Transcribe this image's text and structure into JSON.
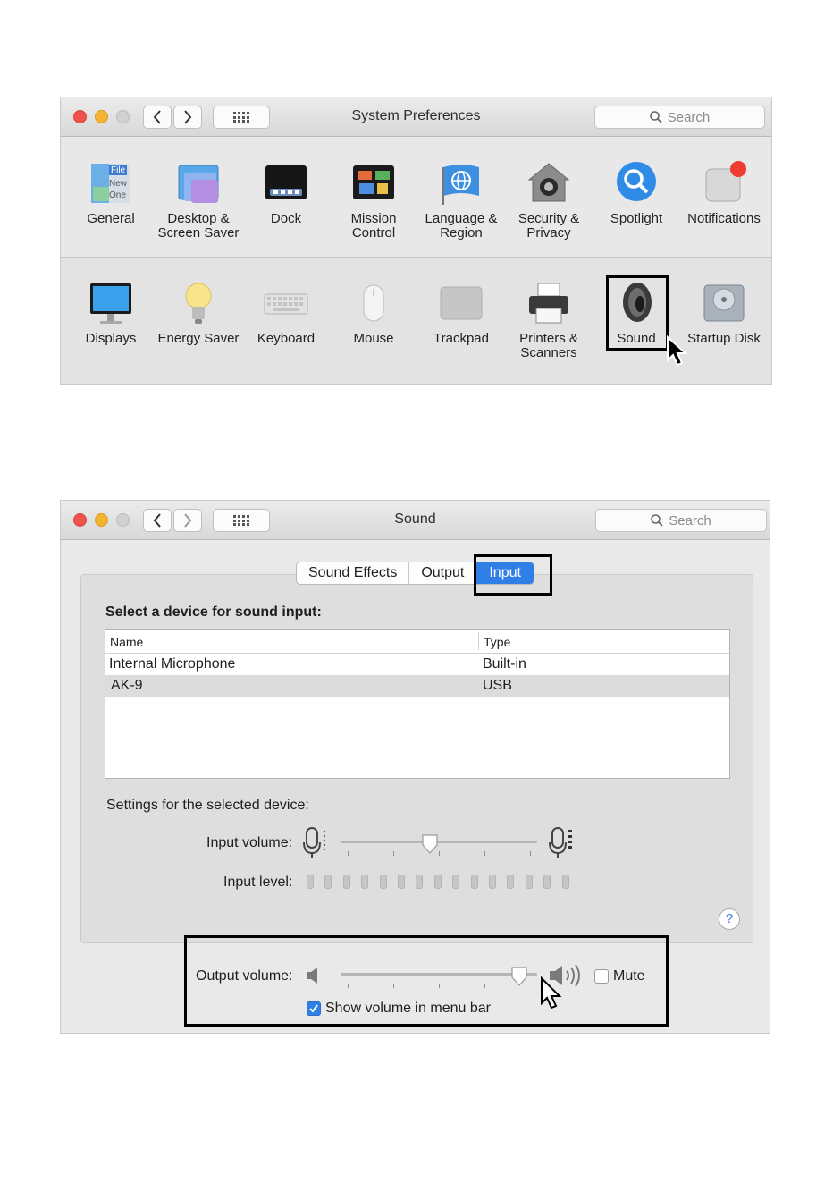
{
  "system_preferences": {
    "title": "System Preferences",
    "search_placeholder": "Search",
    "row1": [
      {
        "label": "General"
      },
      {
        "label": "Desktop & Screen Saver"
      },
      {
        "label": "Dock"
      },
      {
        "label": "Mission Control"
      },
      {
        "label": "Language & Region"
      },
      {
        "label": "Security & Privacy"
      },
      {
        "label": "Spotlight"
      },
      {
        "label": "Notifications"
      }
    ],
    "row2": [
      {
        "label": "Displays"
      },
      {
        "label": "Energy Saver"
      },
      {
        "label": "Keyboard"
      },
      {
        "label": "Mouse"
      },
      {
        "label": "Trackpad"
      },
      {
        "label": "Printers & Scanners"
      },
      {
        "label": "Sound"
      },
      {
        "label": "Startup Disk"
      }
    ],
    "general_icon_text": [
      "File",
      "New",
      "One"
    ]
  },
  "sound_window": {
    "title": "Sound",
    "search_placeholder": "Search",
    "tabs": [
      "Sound Effects",
      "Output",
      "Input"
    ],
    "active_tab": "Input",
    "select_device_heading": "Select a device for sound input:",
    "table": {
      "columns": [
        "Name",
        "Type"
      ],
      "rows": [
        {
          "name": "Internal Microphone",
          "type": "Built-in"
        },
        {
          "name": "AK-9",
          "type": "USB",
          "selected": true
        }
      ]
    },
    "settings_heading": "Settings for the selected device:",
    "input_volume_label": "Input volume:",
    "input_volume_value": 0.45,
    "input_level_label": "Input level:",
    "input_level_segments": 15,
    "help_label": "?",
    "output_volume_label": "Output volume:",
    "output_volume_value": 0.95,
    "mute_label": "Mute",
    "mute_checked": false,
    "show_volume_label": "Show volume in menu bar",
    "show_volume_checked": true
  },
  "colors": {
    "accent": "#2f7fe6",
    "close": "#f0524d",
    "minimize": "#f5b333"
  }
}
